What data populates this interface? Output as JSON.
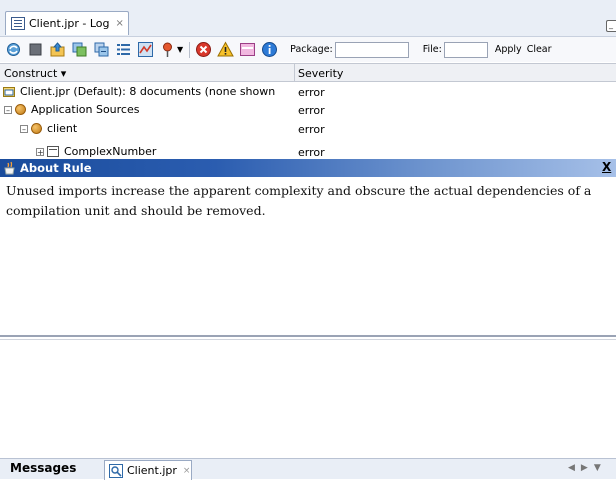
{
  "window": {
    "tab_title": "Client.jpr - Log",
    "tab_close": "×",
    "minimize_glyph": "_"
  },
  "toolbar": {
    "icons": [
      "refresh-icon",
      "stop-icon",
      "export-icon",
      "copy-icon",
      "collapse-icon",
      "list-icon",
      "chart-icon",
      "pin-icon",
      "error-filter-icon",
      "warning-filter-icon",
      "message-filter-icon",
      "info-filter-icon"
    ],
    "package_label": "Package:",
    "package_value": "",
    "file_label": "File:",
    "file_value": "",
    "apply_label": "Apply",
    "clear_label": "Clear"
  },
  "table": {
    "col_construct": "Construct ▾",
    "col_severity": "Severity",
    "rows": [
      {
        "construct": "Client.jpr (Default): 8 documents (none shown",
        "severity": "error"
      },
      {
        "construct": "Application Sources",
        "severity": "error"
      },
      {
        "construct": "client",
        "severity": "error"
      },
      {
        "construct": "ComplexNumber",
        "severity": "error"
      }
    ]
  },
  "about": {
    "title": "About Rule",
    "close": "X",
    "text": "Unused imports increase the apparent complexity and obscure the actual dependencies of a compilation unit and should be removed."
  },
  "bottom": {
    "messages_tab": "Messages",
    "jpr_tab": "Client.jpr",
    "jpr_close": "×"
  },
  "colors": {
    "about_bar_start": "#1a4c9c",
    "about_bar_end": "#a6c0e8",
    "chrome_bg": "#e9eef6"
  }
}
